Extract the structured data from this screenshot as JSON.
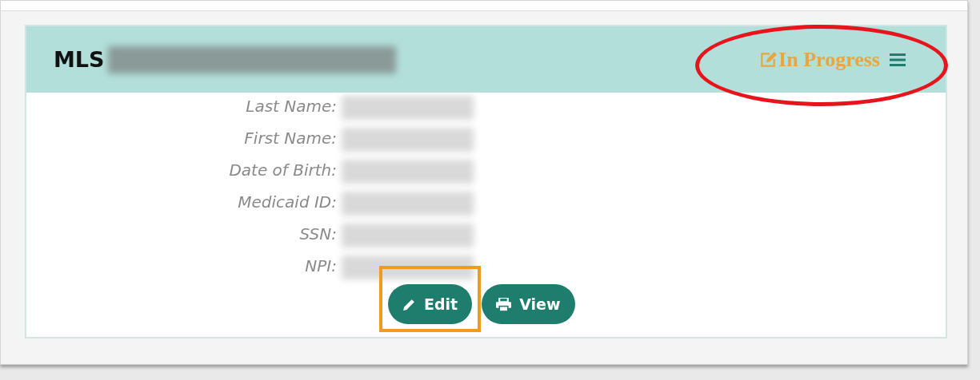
{
  "card": {
    "title": "MLS",
    "title_redacted": true,
    "status": {
      "label": "In Progress",
      "circled": true
    },
    "fields": [
      {
        "label": "Last Name:",
        "redacted": true
      },
      {
        "label": "First Name:",
        "redacted": true
      },
      {
        "label": "Date of Birth:",
        "redacted": true
      },
      {
        "label": "Medicaid ID:",
        "redacted": true
      },
      {
        "label": "SSN:",
        "redacted": true
      },
      {
        "label": "NPI:",
        "redacted": true
      }
    ],
    "buttons": [
      {
        "label": "Edit",
        "kind": "edit",
        "highlighted": true
      },
      {
        "label": "View",
        "kind": "print",
        "highlighted": false
      }
    ]
  }
}
